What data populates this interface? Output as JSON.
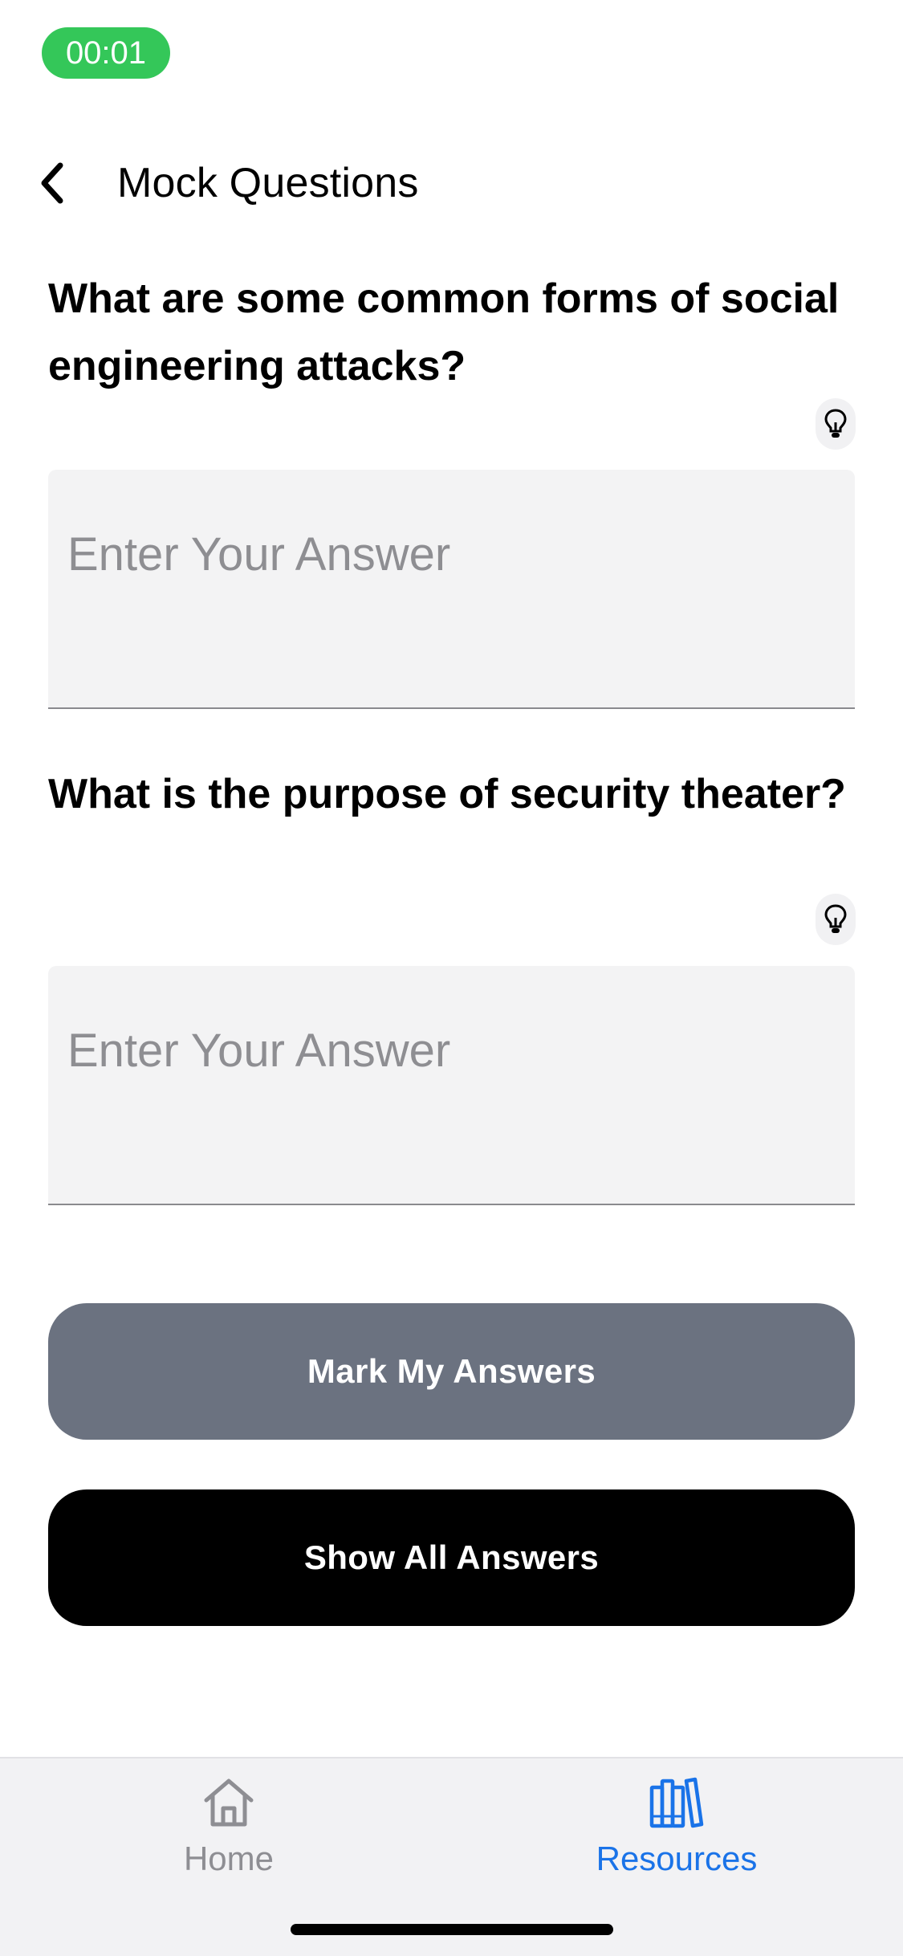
{
  "status": {
    "timer": "00:01",
    "timer_color": "#34c759"
  },
  "header": {
    "title": "Mock Questions",
    "back_icon": "chevron-left-icon"
  },
  "questions": [
    {
      "text": "What are some common forms of social engineering attacks?",
      "hint_icon": "lightbulb-icon",
      "answer_placeholder": "Enter Your Answer",
      "answer_value": ""
    },
    {
      "text": "What is the purpose of security theater?",
      "hint_icon": "lightbulb-icon",
      "answer_placeholder": "Enter Your Answer",
      "answer_value": ""
    }
  ],
  "actions": {
    "mark_label": "Mark My Answers",
    "mark_color": "#6b7280",
    "show_label": "Show All Answers",
    "show_color": "#000000"
  },
  "tabbar": {
    "items": [
      {
        "label": "Home",
        "icon": "home-icon",
        "active": false
      },
      {
        "label": "Resources",
        "icon": "books-icon",
        "active": true
      }
    ],
    "active_color": "#1a73e8",
    "inactive_color": "#8e8e93"
  }
}
